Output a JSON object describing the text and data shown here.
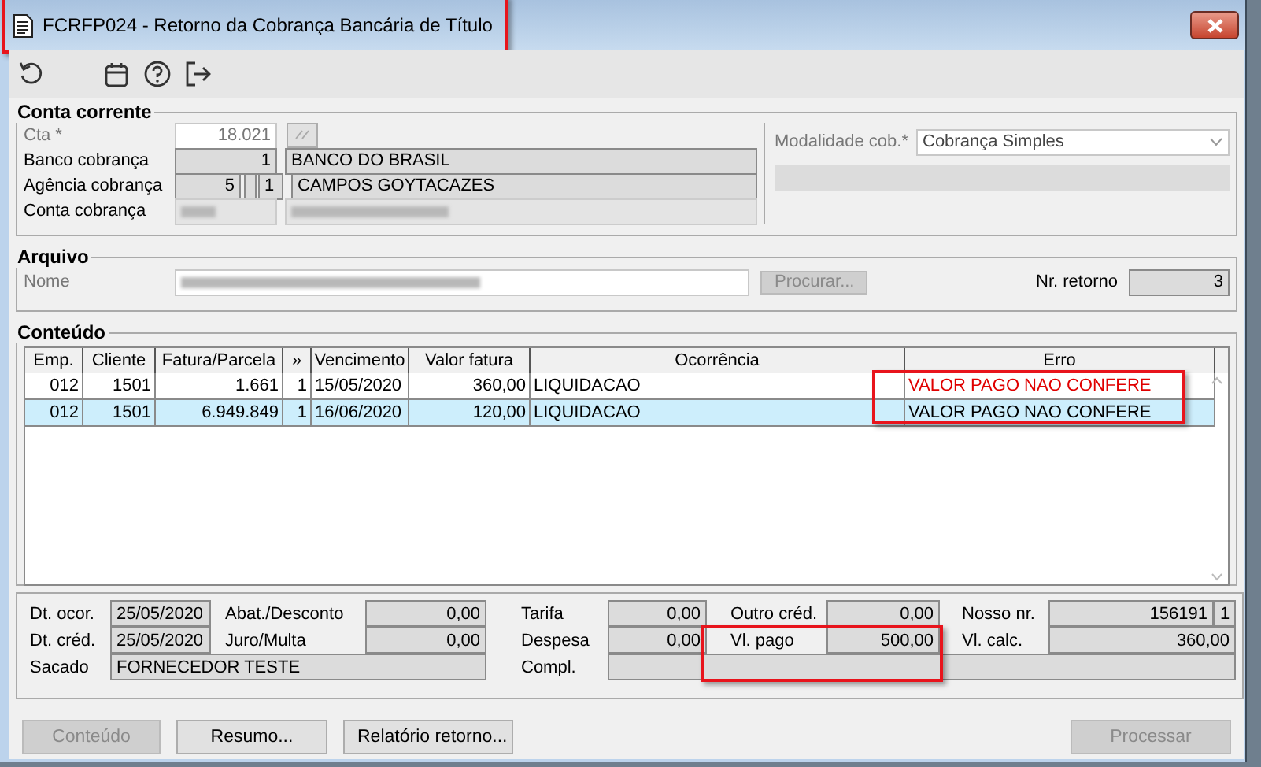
{
  "window": {
    "title": "FCRFP024 - Retorno da Cobrança Bancária de Título"
  },
  "toolbar": [
    {
      "kind": "undo"
    },
    {
      "kind": "calendar"
    },
    {
      "kind": "help"
    },
    {
      "kind": "exit"
    }
  ],
  "conta_corrente": {
    "title": "Conta corrente",
    "cta": {
      "label": "Cta *",
      "value": "18.021"
    },
    "banco": {
      "label": "Banco cobrança",
      "code": "1",
      "name": "BANCO DO BRASIL"
    },
    "agencia": {
      "label": "Agência cobrança",
      "code": "5",
      "digit": "1",
      "name": "CAMPOS GOYTACAZES"
    },
    "conta": {
      "label": "Conta cobrança"
    },
    "modalidade": {
      "label": "Modalidade cob.*",
      "value": "Cobrança Simples"
    }
  },
  "arquivo": {
    "title": "Arquivo",
    "nome_label": "Nome",
    "procurar": {
      "label": "Procurar...",
      "disabled": true
    },
    "nr_retorno": {
      "label": "Nr. retorno",
      "value": "3"
    }
  },
  "conteudo": {
    "title": "Conteúdo",
    "columns": [
      "Emp.",
      "Cliente",
      "Fatura/Parcela",
      "»",
      "Vencimento",
      "Valor fatura",
      "Ocorrência",
      "Erro"
    ],
    "rows": [
      {
        "selected": false,
        "cells": [
          "012",
          "1501",
          "1.661",
          "1",
          "15/05/2020",
          "360,00",
          "LIQUIDACAO",
          "VALOR PAGO NAO CONFERE"
        ]
      },
      {
        "selected": true,
        "cells": [
          "012",
          "1501",
          "6.949.849",
          "1",
          "16/06/2020",
          "120,00",
          "LIQUIDACAO",
          "VALOR PAGO NAO CONFERE"
        ]
      }
    ]
  },
  "details": {
    "dt_ocor": {
      "label": "Dt. ocor.",
      "value": "25/05/2020"
    },
    "abat": {
      "label": "Abat./Desconto",
      "value": "0,00"
    },
    "tarifa": {
      "label": "Tarifa",
      "value": "0,00"
    },
    "outro": {
      "label": "Outro créd.",
      "value": "0,00"
    },
    "nosso": {
      "label": "Nosso nr.",
      "value": "156191",
      "digit": "1"
    },
    "dt_cred": {
      "label": "Dt. créd.",
      "value": "25/05/2020"
    },
    "juro": {
      "label": "Juro/Multa",
      "value": "0,00"
    },
    "despesa": {
      "label": "Despesa",
      "value": "0,00"
    },
    "vl_pago": {
      "label": "Vl. pago",
      "value": "500,00"
    },
    "vl_calc": {
      "label": "Vl. calc.",
      "value": "360,00"
    },
    "sacado": {
      "label": "Sacado",
      "value": "FORNECEDOR TESTE"
    },
    "compl": {
      "label": "Compl."
    }
  },
  "buttons_left": [
    {
      "label": "Conteúdo",
      "disabled": true
    },
    {
      "label": "Resumo...",
      "disabled": false
    },
    {
      "label": "Relatório retorno...",
      "disabled": false
    }
  ],
  "buttons_right": [
    {
      "label": "Processar",
      "disabled": true
    }
  ]
}
